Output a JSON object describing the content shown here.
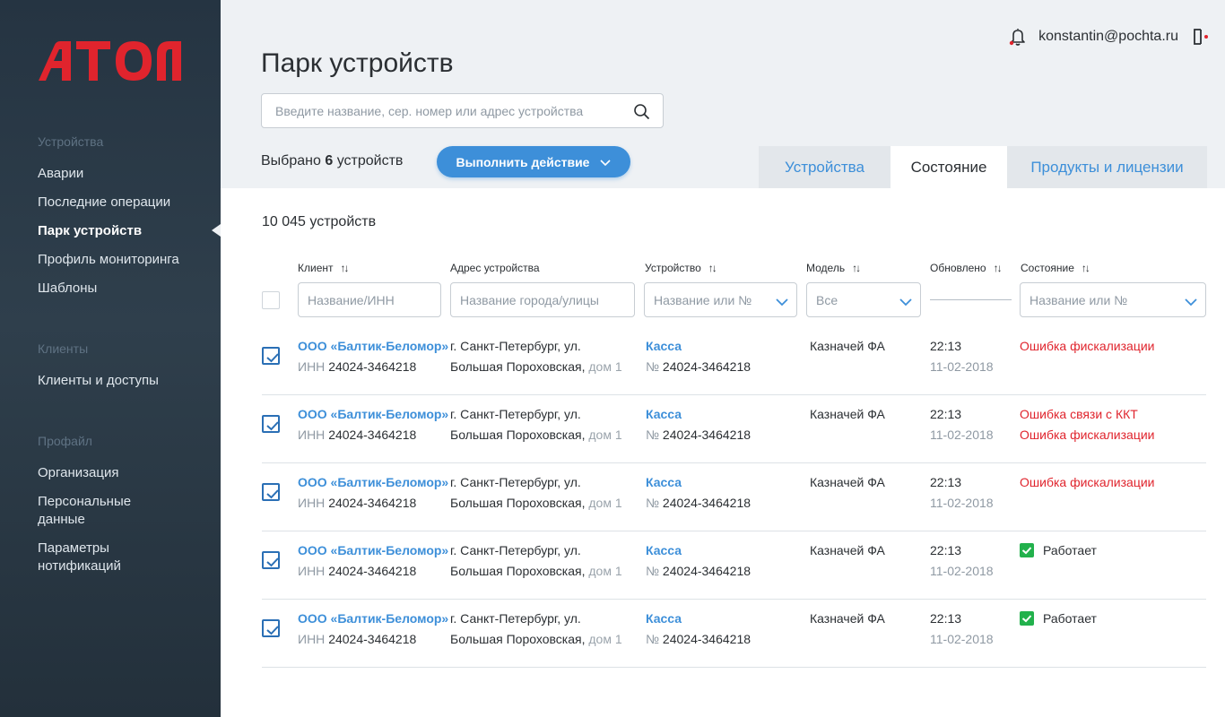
{
  "brand": {
    "logo_text": "АТОЛ",
    "accent": "#e0242d"
  },
  "sidebar": {
    "sections": [
      {
        "title": "Устройства",
        "items": [
          "Аварии",
          "Последние операции",
          "Парк устройств",
          "Профиль мониторинга",
          "Шаблоны"
        ]
      },
      {
        "title": "Клиенты",
        "items": [
          "Клиенты и доступы"
        ]
      },
      {
        "title": "Профайл",
        "items": [
          "Организация",
          "Персональные данные",
          "Параметры нотификаций"
        ]
      }
    ],
    "active_item": "Парк устройств"
  },
  "header": {
    "title": "Парк устройств",
    "user_email": "konstantin@pochta.ru",
    "search_placeholder": "Введите название, сер. номер или адрес устройства"
  },
  "toolbar": {
    "selected_prefix": "Выбрано",
    "selected_count": "6",
    "selected_suffix": "устройств",
    "action_label": "Выполнить действие"
  },
  "tabs": [
    {
      "label": "Устройства",
      "active": false
    },
    {
      "label": "Состояние",
      "active": true
    },
    {
      "label": "Продукты и лицензии",
      "active": false
    }
  ],
  "table": {
    "total": "10 045 устройств",
    "columns": {
      "client": "Клиент",
      "address": "Адрес устройства",
      "device": "Устройство",
      "model": "Модель",
      "updated": "Обновлено",
      "state": "Состояние"
    },
    "filters": {
      "client": "Название/ИНН",
      "address": "Название города/улицы",
      "device": "Название или №",
      "model": "Все",
      "state": "Название или №"
    },
    "rows": [
      {
        "client": "ООО «Балтик-Беломор»",
        "inn_label": "ИНН",
        "inn": "24024-3464218",
        "addr1": "г. Санкт-Петербург, ул.",
        "addr2": "Большая Пороховская,",
        "addr2_fade": "дом 1",
        "device": "Касса",
        "num_label": "№",
        "num": "24024-3464218",
        "model": "Казначей ФА",
        "time": "22:13",
        "date": "11-02-2018",
        "state1": "Ошибка фискализации",
        "state2": ""
      },
      {
        "client": "ООО «Балтик-Беломор»",
        "inn_label": "ИНН",
        "inn": "24024-3464218",
        "addr1": "г. Санкт-Петербург, ул.",
        "addr2": "Большая Пороховская,",
        "addr2_fade": "дом 1",
        "device": "Касса",
        "num_label": "№",
        "num": "24024-3464218",
        "model": "Казначей ФА",
        "time": "22:13",
        "date": "11-02-2018",
        "state1": "Ошибка связи с ККТ",
        "state2": "Ошибка фискализации"
      },
      {
        "client": "ООО «Балтик-Беломор»",
        "inn_label": "ИНН",
        "inn": "24024-3464218",
        "addr1": "г. Санкт-Петербург, ул.",
        "addr2": "Большая Пороховская,",
        "addr2_fade": "дом 1",
        "device": "Касса",
        "num_label": "№",
        "num": "24024-3464218",
        "model": "Казначей ФА",
        "time": "22:13",
        "date": "11-02-2018",
        "state1": "Ошибка фискализации",
        "state2": ""
      },
      {
        "client": "ООО «Балтик-Беломор»",
        "inn_label": "ИНН",
        "inn": "24024-3464218",
        "addr1": "г. Санкт-Петербург, ул.",
        "addr2": "Большая Пороховская,",
        "addr2_fade": "дом 1",
        "device": "Касса",
        "num_label": "№",
        "num": "24024-3464218",
        "model": "Казначей ФА",
        "time": "22:13",
        "date": "11-02-2018",
        "ok": "Работает"
      },
      {
        "client": "ООО «Балтик-Беломор»",
        "inn_label": "ИНН",
        "inn": "24024-3464218",
        "addr1": "г. Санкт-Петербург, ул.",
        "addr2": "Большая Пороховская,",
        "addr2_fade": "дом 1",
        "device": "Касса",
        "num_label": "№",
        "num": "24024-3464218",
        "model": "Казначей ФА",
        "time": "22:13",
        "date": "11-02-2018",
        "ok": "Работает"
      }
    ]
  },
  "colors": {
    "link": "#3d8fd9",
    "error": "#e0242d",
    "ok": "#22b14c",
    "sidebar": "#2a3a47"
  }
}
